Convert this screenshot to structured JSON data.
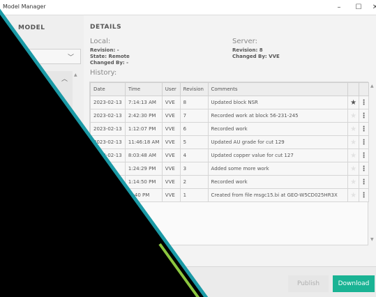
{
  "window": {
    "title": "Model Manager",
    "minimize": "–",
    "maximize": "☐",
    "close": "✕"
  },
  "left_panel": {
    "title": "MODEL",
    "select_chevron": "﹀",
    "list_chevron": "︿"
  },
  "details": {
    "title": "DETAILS",
    "local": {
      "label": "Local:",
      "revision": "Revision: -",
      "state": "State: Remote",
      "changed_by": "Changed By: -"
    },
    "server": {
      "label": "Server:",
      "revision": "Revision: 8",
      "changed_by": "Changed By: VVE"
    },
    "history_label": "History:"
  },
  "table": {
    "columns": [
      "Date",
      "Time",
      "User",
      "Revision",
      "Comments",
      "",
      ""
    ],
    "rows": [
      {
        "date": "2023-02-13",
        "time": "7:14:13 AM",
        "user": "VVE",
        "revision": "8",
        "comment": "Updated block NSR",
        "starred": true
      },
      {
        "date": "2023-02-13",
        "time": "2:42:30 PM",
        "user": "VVE",
        "revision": "7",
        "comment": "Recorded work at block 56-231-245",
        "starred": false
      },
      {
        "date": "2023-02-13",
        "time": "1:12:07 PM",
        "user": "VVE",
        "revision": "6",
        "comment": "Recorded work",
        "starred": false
      },
      {
        "date": "2023-02-13",
        "time": "11:46:18 AM",
        "user": "VVE",
        "revision": "5",
        "comment": "Updated AU grade for cut 129",
        "starred": false
      },
      {
        "date": "2023-02-13",
        "time": "8:03:48 AM",
        "user": "VVE",
        "revision": "4",
        "comment": "Updated copper value for cut 127",
        "starred": false
      },
      {
        "date": "",
        "time": "1:24:29 PM",
        "user": "VVE",
        "revision": "3",
        "comment": "Added some more work",
        "starred": false
      },
      {
        "date": "",
        "time": "1:14:50 PM",
        "user": "VVE",
        "revision": "2",
        "comment": "Recorded work",
        "starred": false
      },
      {
        "date": "",
        "time": "...:40 PM",
        "user": "VVE",
        "revision": "1",
        "comment": "Created from file msgc15.bi at GEO-W5CD025HR3X",
        "starred": false
      }
    ],
    "star_glyph": "★",
    "menu_glyph": "⋮"
  },
  "footer": {
    "publish_label": "Publish",
    "download_label": "Download"
  },
  "colors": {
    "accent": "#1ab394",
    "diagonal_teal": "#1b9aa6",
    "diagonal_green": "#8cc63f",
    "overlay_black": "#000000"
  }
}
